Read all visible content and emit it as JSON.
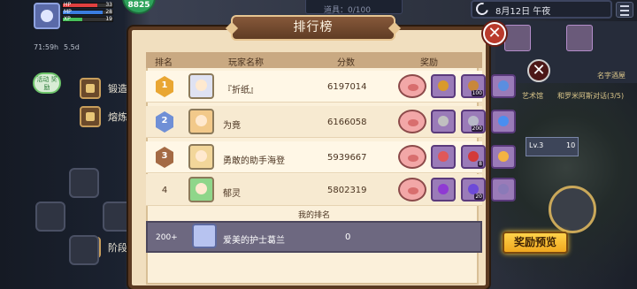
{
  "hud": {
    "hp_label": "HP",
    "hp_value": "33",
    "hp_frac": 0.7,
    "mp_label": "MP",
    "mp_value": "28",
    "mp_frac": 0.8,
    "xp_label": "XP",
    "xp_value": "19",
    "xp_frac": 0.4,
    "gold_value": "8825",
    "timer_1": "71:59h",
    "timer_2": "5.5d",
    "progress_top": "道具：0/100",
    "date": "8月12日 午夜",
    "event_badge": "活动\n奖励"
  },
  "side_buttons": [
    {
      "label": "锻造"
    },
    {
      "label": "熔炼"
    },
    {
      "label": "阶段"
    }
  ],
  "right_panel": {
    "text_1": "名字酒屋",
    "text_2": "艺术馆",
    "text_3": "巴兰德",
    "text_4": "和罗米阿斯对话(3/5)",
    "level_1": "Lv.3",
    "level_2": "10",
    "reward_preview_label": "奖励预览"
  },
  "leaderboard": {
    "title": "排行榜",
    "headers": {
      "rank": "排名",
      "player": "玩家名称",
      "score": "分数",
      "reward": "奖励"
    },
    "rows": [
      {
        "rank": "1",
        "name": "『折纸』",
        "score": "6197014",
        "items": [
          {
            "count": "",
            "color": "#d99a2b"
          },
          {
            "count": "100",
            "color": "#c9873b"
          },
          {
            "count": "",
            "color": "#5a8ee0"
          }
        ],
        "medal": "#e9a632",
        "face": "#dfe2f2"
      },
      {
        "rank": "2",
        "name": "为竟",
        "score": "6166058",
        "items": [
          {
            "count": "",
            "color": "#c0c0c0"
          },
          {
            "count": "200",
            "color": "#b8b8c8"
          },
          {
            "count": "",
            "color": "#4a8ef0"
          }
        ],
        "medal": "#6f8fd6",
        "face": "#f2c98a"
      },
      {
        "rank": "3",
        "name": "勇敢的助手海登",
        "score": "5939667",
        "items": [
          {
            "count": "",
            "color": "#e05858"
          },
          {
            "count": "8",
            "color": "#d33a3a"
          },
          {
            "count": "",
            "color": "#f3b343"
          }
        ],
        "medal": "#a46a44",
        "face": "#f2d69a"
      },
      {
        "rank": "4",
        "name": "郁灵",
        "score": "5802319",
        "items": [
          {
            "count": "",
            "color": "#8f3ad3"
          },
          {
            "count": "20",
            "color": "#6d4ad8"
          },
          {
            "count": "",
            "color": "#8a7ab8"
          }
        ],
        "medal": "",
        "face": "#8fd68a"
      }
    ],
    "my_rank_title": "我的排名",
    "my": {
      "rank": "200+",
      "name": "爱美的护士葛兰",
      "score": "0"
    }
  }
}
